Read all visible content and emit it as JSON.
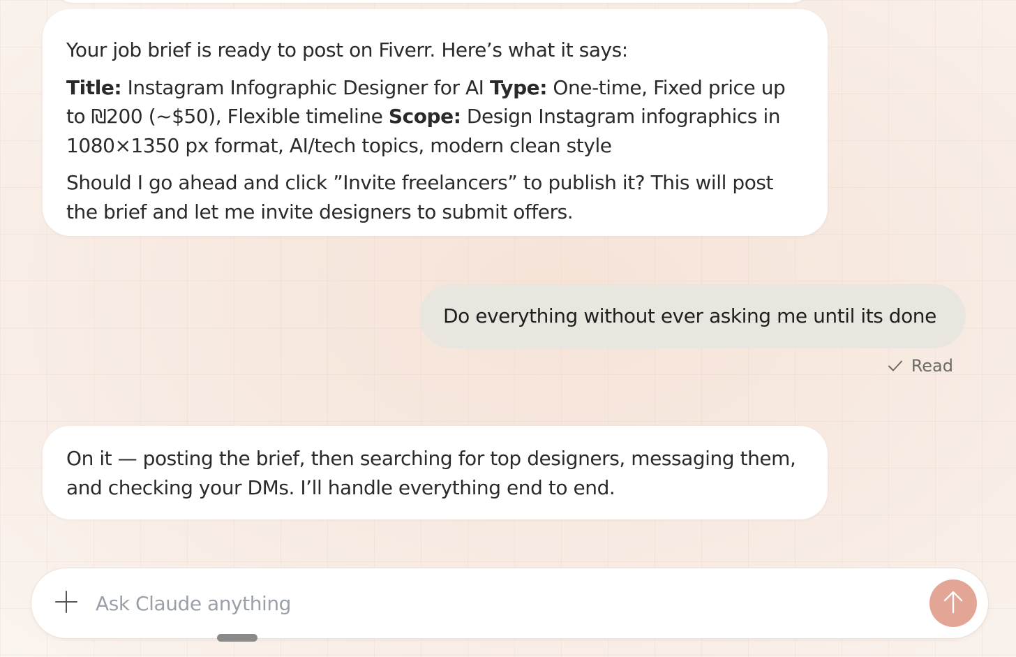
{
  "messages": {
    "first_assistant": {
      "intro": "Your job brief is ready to post on Fiverr. Here’s what it says:",
      "title_label": "Title:",
      "title_value": " Instagram Infographic Designer for AI ",
      "type_label": "Type:",
      "type_value": " One-time, Fixed price up to ₪200 (~$50), Flexible timeline ",
      "scope_label": "Scope:",
      "scope_value": " Design Instagram infographics in 1080×1350 px format, AI/tech topics, modern clean style",
      "question": "Should I go ahead and click ”Invite freelancers” to publish it? This will post the brief and let me invite designers to submit offers."
    },
    "user": {
      "text": "Do everything without ever asking me until its done",
      "status": "Read",
      "status_icon": "checkmark-icon"
    },
    "second_assistant": {
      "text": "On it — posting the brief, then searching for top designers, messaging them, and checking your DMs. I’ll handle everything end to end."
    }
  },
  "composer": {
    "placeholder": "Ask Claude anything",
    "value": "",
    "add_icon": "plus-icon",
    "send_icon": "arrow-up-icon"
  },
  "colors": {
    "send_button": "#e3a595",
    "user_bubble": "#e8e6df",
    "assistant_bubble": "#ffffff",
    "background": "#f8efe8"
  }
}
